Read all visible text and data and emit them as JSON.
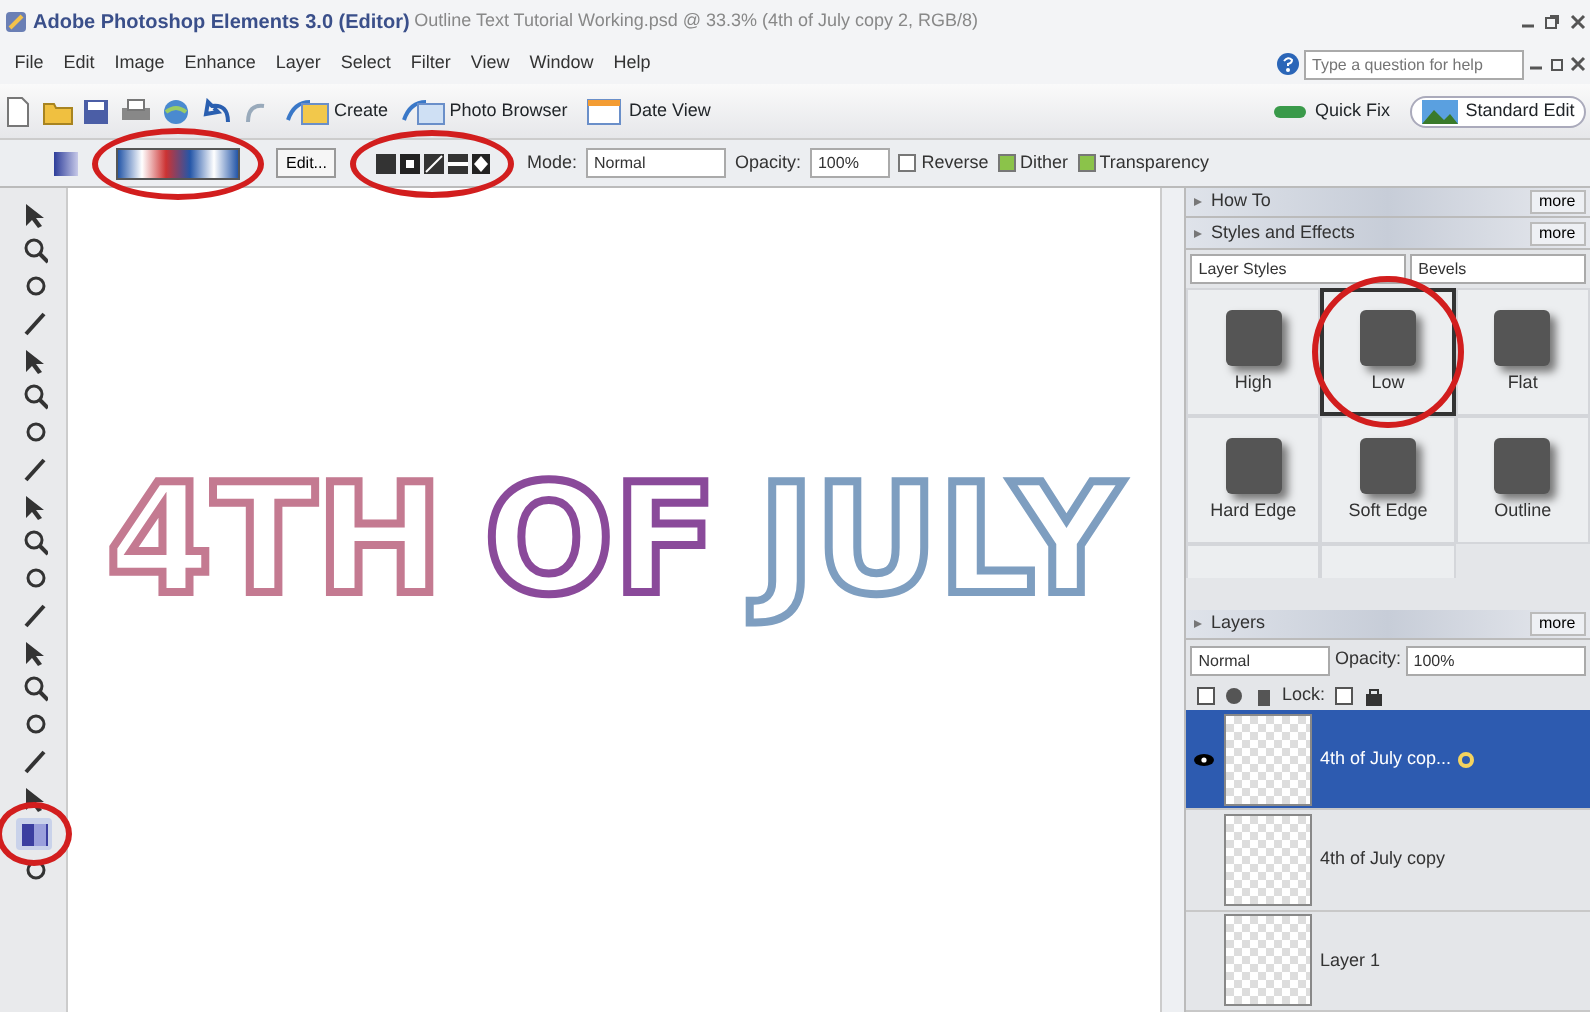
{
  "window": {
    "app_title": "Adobe Photoshop Elements 3.0 (Editor)",
    "document_title": "Outline Text Tutorial Working.psd @ 33.3% (4th of July copy 2, RGB/8)"
  },
  "menu": [
    "File",
    "Edit",
    "Image",
    "Enhance",
    "Layer",
    "Select",
    "Filter",
    "View",
    "Window",
    "Help"
  ],
  "help": {
    "placeholder": "Type a question for help"
  },
  "shortcuts": [
    {
      "label": "Create"
    },
    {
      "label": "Photo Browser"
    },
    {
      "label": "Date View"
    }
  ],
  "modes": [
    {
      "label": "Quick Fix",
      "selected": false
    },
    {
      "label": "Standard Edit",
      "selected": true
    }
  ],
  "options_bar": {
    "gradient_circled": true,
    "edit_button": "Edit...",
    "types_circled": true,
    "mode_label": "Mode:",
    "mode": "Normal",
    "opacity_label": "Opacity:",
    "opacity": "100%",
    "checks": [
      {
        "label": "Reverse",
        "checked": false
      },
      {
        "label": "Dither",
        "checked": true
      },
      {
        "label": "Transparency",
        "checked": true
      }
    ]
  },
  "tools": [
    {
      "selected": false,
      "circled": false
    },
    {
      "selected": false,
      "circled": false
    },
    {
      "selected": false,
      "circled": false
    },
    {
      "selected": false,
      "circled": false
    },
    {
      "selected": false,
      "circled": false
    },
    {
      "selected": false,
      "circled": false
    },
    {
      "selected": false,
      "circled": false
    },
    {
      "selected": false,
      "circled": false
    },
    {
      "selected": false,
      "circled": false
    },
    {
      "selected": false,
      "circled": false
    },
    {
      "selected": false,
      "circled": false
    },
    {
      "selected": false,
      "circled": false
    },
    {
      "selected": false,
      "circled": false
    },
    {
      "selected": false,
      "circled": false
    },
    {
      "selected": false,
      "circled": false
    },
    {
      "selected": false,
      "circled": false
    },
    {
      "selected": false,
      "circled": false
    },
    {
      "selected": true,
      "circled": true
    },
    {
      "selected": false,
      "circled": false
    }
  ],
  "canvas": {
    "words": [
      "4TH",
      "OF",
      "JULY"
    ]
  },
  "palettes": {
    "how_to": {
      "title": "How To",
      "more": "more"
    },
    "styles": {
      "title": "Styles and Effects",
      "more": "more",
      "category": "Layer Styles",
      "library": "Bevels",
      "tiles": [
        {
          "label": "High",
          "selected": false,
          "circled": false
        },
        {
          "label": "Low",
          "selected": true,
          "circled": true
        },
        {
          "label": "Flat",
          "selected": false,
          "circled": false
        },
        {
          "label": "Hard Edge",
          "selected": false,
          "circled": false
        },
        {
          "label": "Soft Edge",
          "selected": false,
          "circled": false
        },
        {
          "label": "Outline",
          "selected": false,
          "circled": false
        },
        {
          "selected": false,
          "circled": false
        },
        {
          "selected": false,
          "circled": false
        }
      ]
    },
    "layers": {
      "title": "Layers",
      "more": "more",
      "blend": "Normal",
      "opacity_label": "Opacity:",
      "opacity": "100%",
      "lock_label": "Lock:",
      "items": [
        {
          "name": "4th of July cop...",
          "selected": true,
          "visible": true
        },
        {
          "name": "4th of July copy",
          "selected": false,
          "visible": false
        },
        {
          "name": "Layer 1",
          "selected": false,
          "visible": false
        }
      ]
    }
  }
}
